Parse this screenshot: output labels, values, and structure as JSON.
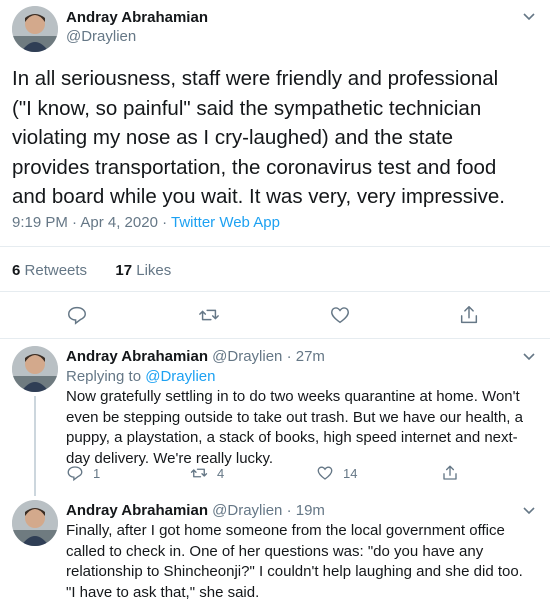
{
  "main_tweet": {
    "author_name": "Andray Abrahamian",
    "author_handle": "@Draylien",
    "text": "In all seriousness, staff were friendly and professional\n(\"I know, so painful\" said the sympathetic technician\nviolating my nose as I cry-laughed) and the state\nprovides transportation, the coronavirus test and food\nand board while you wait. It was very, very impressive.",
    "time": "9:19 PM · Apr 4, 2020 · ",
    "app": "Twitter Web App",
    "retweets_count": "6",
    "retweets_label": "Retweets",
    "likes_count": "17",
    "likes_label": "Likes"
  },
  "replies": [
    {
      "author_name": "Andray Abrahamian",
      "author_handle": "@Draylien",
      "age": "27m",
      "replying_prefix": "Replying to ",
      "replying_to": "@Draylien",
      "text": "Now gratefully settling in to do two weeks quarantine at home. Won't even be stepping outside to take out trash. But we have our health, a puppy, a playstation, a stack of books, high speed internet and next-day delivery. We're really lucky.",
      "reply_count": "1",
      "retweet_count": "4",
      "like_count": "14"
    },
    {
      "author_name": "Andray Abrahamian",
      "author_handle": "@Draylien",
      "age": "19m",
      "text": "Finally, after I got home someone from the local government office called to check in. One of her questions was: \"do you have any relationship to Shincheonji?\" I couldn't help laughing and she did too. \"I have to ask that,\" she said."
    }
  ],
  "colors": {
    "link": "#1da1f2",
    "secondary": "#657786",
    "divider": "#e6ecf0",
    "icon": "#657786"
  }
}
